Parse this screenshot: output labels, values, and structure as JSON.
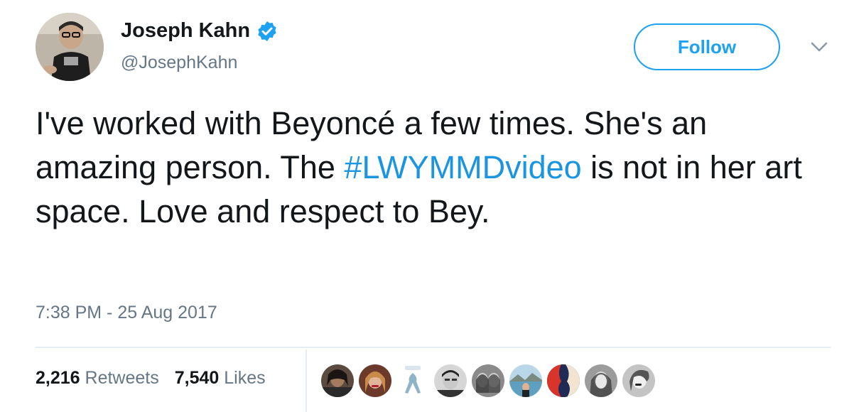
{
  "author": {
    "display_name": "Joseph Kahn",
    "handle": "@JosephKahn",
    "verified_icon": "verified-badge-icon",
    "avatar_icon": "avatar-image"
  },
  "actions": {
    "follow_label": "Follow",
    "more_icon": "chevron-down-icon"
  },
  "tweet": {
    "text_before": "I've worked with Beyoncé a few times. She's an amazing person. The ",
    "hashtag": "#LWYMMDvideo",
    "text_after": " is not in her art space. Love and respect to Bey.",
    "timestamp": "7:38 PM - 25 Aug 2017"
  },
  "stats": {
    "retweets_count": "2,216",
    "retweets_label": "Retweets",
    "likes_count": "7,540",
    "likes_label": "Likes"
  },
  "colors": {
    "accent": "#1da1f2",
    "hashtag": "#1b95e0",
    "muted": "#657786",
    "text": "#14171a",
    "divider": "#e6ecf0"
  }
}
